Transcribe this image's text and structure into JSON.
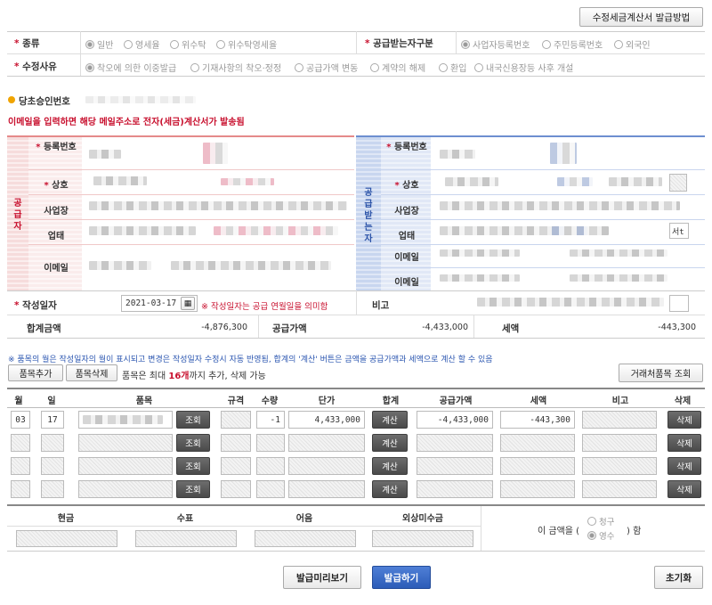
{
  "top_button": "수정세금계산서 발급방법",
  "kind": {
    "label": "종류",
    "options": [
      "일반",
      "영세율",
      "위수탁",
      "위수탁영세율"
    ],
    "selected": 0
  },
  "receiver_type": {
    "label": "공급받는자구분",
    "options": [
      "사업자등록번호",
      "주민등록번호",
      "외국인"
    ],
    "selected": 0
  },
  "modify_reason": {
    "label": "수정사유",
    "options": [
      "착오에 의한 이중발급",
      "기재사항의 착오·정정",
      "공급가액 변동",
      "계약의 해제",
      "환입",
      "내국신용장등 사후 개설"
    ],
    "selected": 0
  },
  "original_approval": {
    "label": "당초승인번호"
  },
  "email_notice": "이메일을 입력하면 해당 메일주소로 전자(세금)계산서가 발송됨",
  "supplier": {
    "side_label": "공급자",
    "fields": [
      "등록번호",
      "상호",
      "사업장",
      "업태",
      "이메일"
    ]
  },
  "buyer": {
    "side_label": "공급받는자",
    "fields": [
      "등록번호",
      "상호",
      "사업장",
      "업태",
      "이메일",
      "이메일"
    ],
    "business_btn": "서t"
  },
  "write_date": {
    "label": "작성일자",
    "value": "2021-03-17",
    "note": "※ 작성일자는 공급 연월일을 의미함"
  },
  "remark_label": "비고",
  "totals": {
    "total_label": "합계금액",
    "total_value": "-4,876,300",
    "supply_label": "공급가액",
    "supply_value": "-4,433,000",
    "tax_label": "세액",
    "tax_value": "-443,300"
  },
  "items_notice": "※ 품목의 월은 작성일자의 월이 표시되고 변경은 작성일자 수정시 자동 반영됨, 합계의 '계산' 버튼은 금액을 공급가액과 세액으로 계산 할 수 있음",
  "item_buttons": {
    "add": "품목추가",
    "delete": "품목삭제",
    "limit_prefix": "품목은 최대",
    "limit_count": "16개",
    "limit_suffix": "까지 추가, 삭제 가능",
    "lookup": "거래처품목 조회"
  },
  "items_table": {
    "headers": [
      "월",
      "일",
      "품목",
      "규격",
      "수량",
      "단가",
      "합계",
      "공급가액",
      "세액",
      "비고",
      "삭제"
    ],
    "lookup_btn": "조회",
    "calc_btn": "계산",
    "delete_btn": "삭제",
    "rows": [
      {
        "month": "03",
        "day": "17",
        "qty": "-1",
        "unit_price": "4,433,000",
        "supply": "-4,433,000",
        "tax": "-443,300"
      },
      {
        "month": "",
        "day": "",
        "qty": "",
        "unit_price": "",
        "supply": "",
        "tax": ""
      },
      {
        "month": "",
        "day": "",
        "qty": "",
        "unit_price": "",
        "supply": "",
        "tax": ""
      },
      {
        "month": "",
        "day": "",
        "qty": "",
        "unit_price": "",
        "supply": "",
        "tax": ""
      }
    ]
  },
  "payment": {
    "headers": [
      "현금",
      "수표",
      "어음",
      "외상미수금"
    ],
    "amount_prefix": "이 금액을 (",
    "amount_suffix": ") 함",
    "claim": "청구",
    "receipt": "영수"
  },
  "actions": {
    "preview": "발급미리보기",
    "issue": "발급하기",
    "reset": "초기화"
  }
}
